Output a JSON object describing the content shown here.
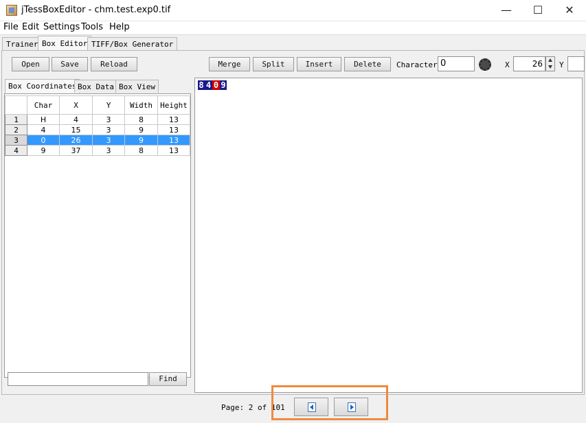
{
  "window": {
    "title": "jTessBoxEditor - chm.test.exp0.tif",
    "controls": {
      "minimize": "—",
      "maximize": "☐",
      "close": "✕"
    }
  },
  "menu": [
    {
      "label": "File"
    },
    {
      "label": "Edit"
    },
    {
      "label": "Settings"
    },
    {
      "label": "Tools"
    },
    {
      "label": "Help"
    }
  ],
  "tabs": [
    {
      "label": "Trainer",
      "active": false
    },
    {
      "label": "Box Editor",
      "active": true
    },
    {
      "label": "TIFF/Box Generator",
      "active": false
    }
  ],
  "toolbar": {
    "open_label": "Open",
    "save_label": "Save",
    "reload_label": "Reload",
    "merge_label": "Merge",
    "split_label": "Split",
    "insert_label": "Insert",
    "delete_label": "Delete",
    "character_label": "Character",
    "character_value": "0",
    "x_label": "X",
    "x_value": "26",
    "y_label": "Y"
  },
  "left_tabs": [
    {
      "label": "Box Coordinates",
      "active": true
    },
    {
      "label": "Box Data",
      "active": false
    },
    {
      "label": "Box View",
      "active": false
    }
  ],
  "table": {
    "columns": [
      "Char",
      "X",
      "Y",
      "Width",
      "Height"
    ],
    "rows": [
      {
        "num": "1",
        "char": "H",
        "x": "4",
        "y": "3",
        "w": "8",
        "h": "13"
      },
      {
        "num": "2",
        "char": "4",
        "x": "15",
        "y": "3",
        "w": "9",
        "h": "13"
      },
      {
        "num": "3",
        "char": "0",
        "x": "26",
        "y": "3",
        "w": "9",
        "h": "13"
      },
      {
        "num": "4",
        "char": "9",
        "x": "37",
        "y": "3",
        "w": "8",
        "h": "13"
      }
    ],
    "selected_row": 3
  },
  "find": {
    "value": "",
    "button_label": "Find"
  },
  "image_glyphs": [
    "8",
    "4",
    "0",
    "9"
  ],
  "status": {
    "page_text": "Page: 2 of 101"
  },
  "colors": {
    "selection": "#3399ff",
    "highlight": "#f08a3c",
    "glyph_box": "#1a1a8c",
    "glyph_selected": "#d10000"
  }
}
